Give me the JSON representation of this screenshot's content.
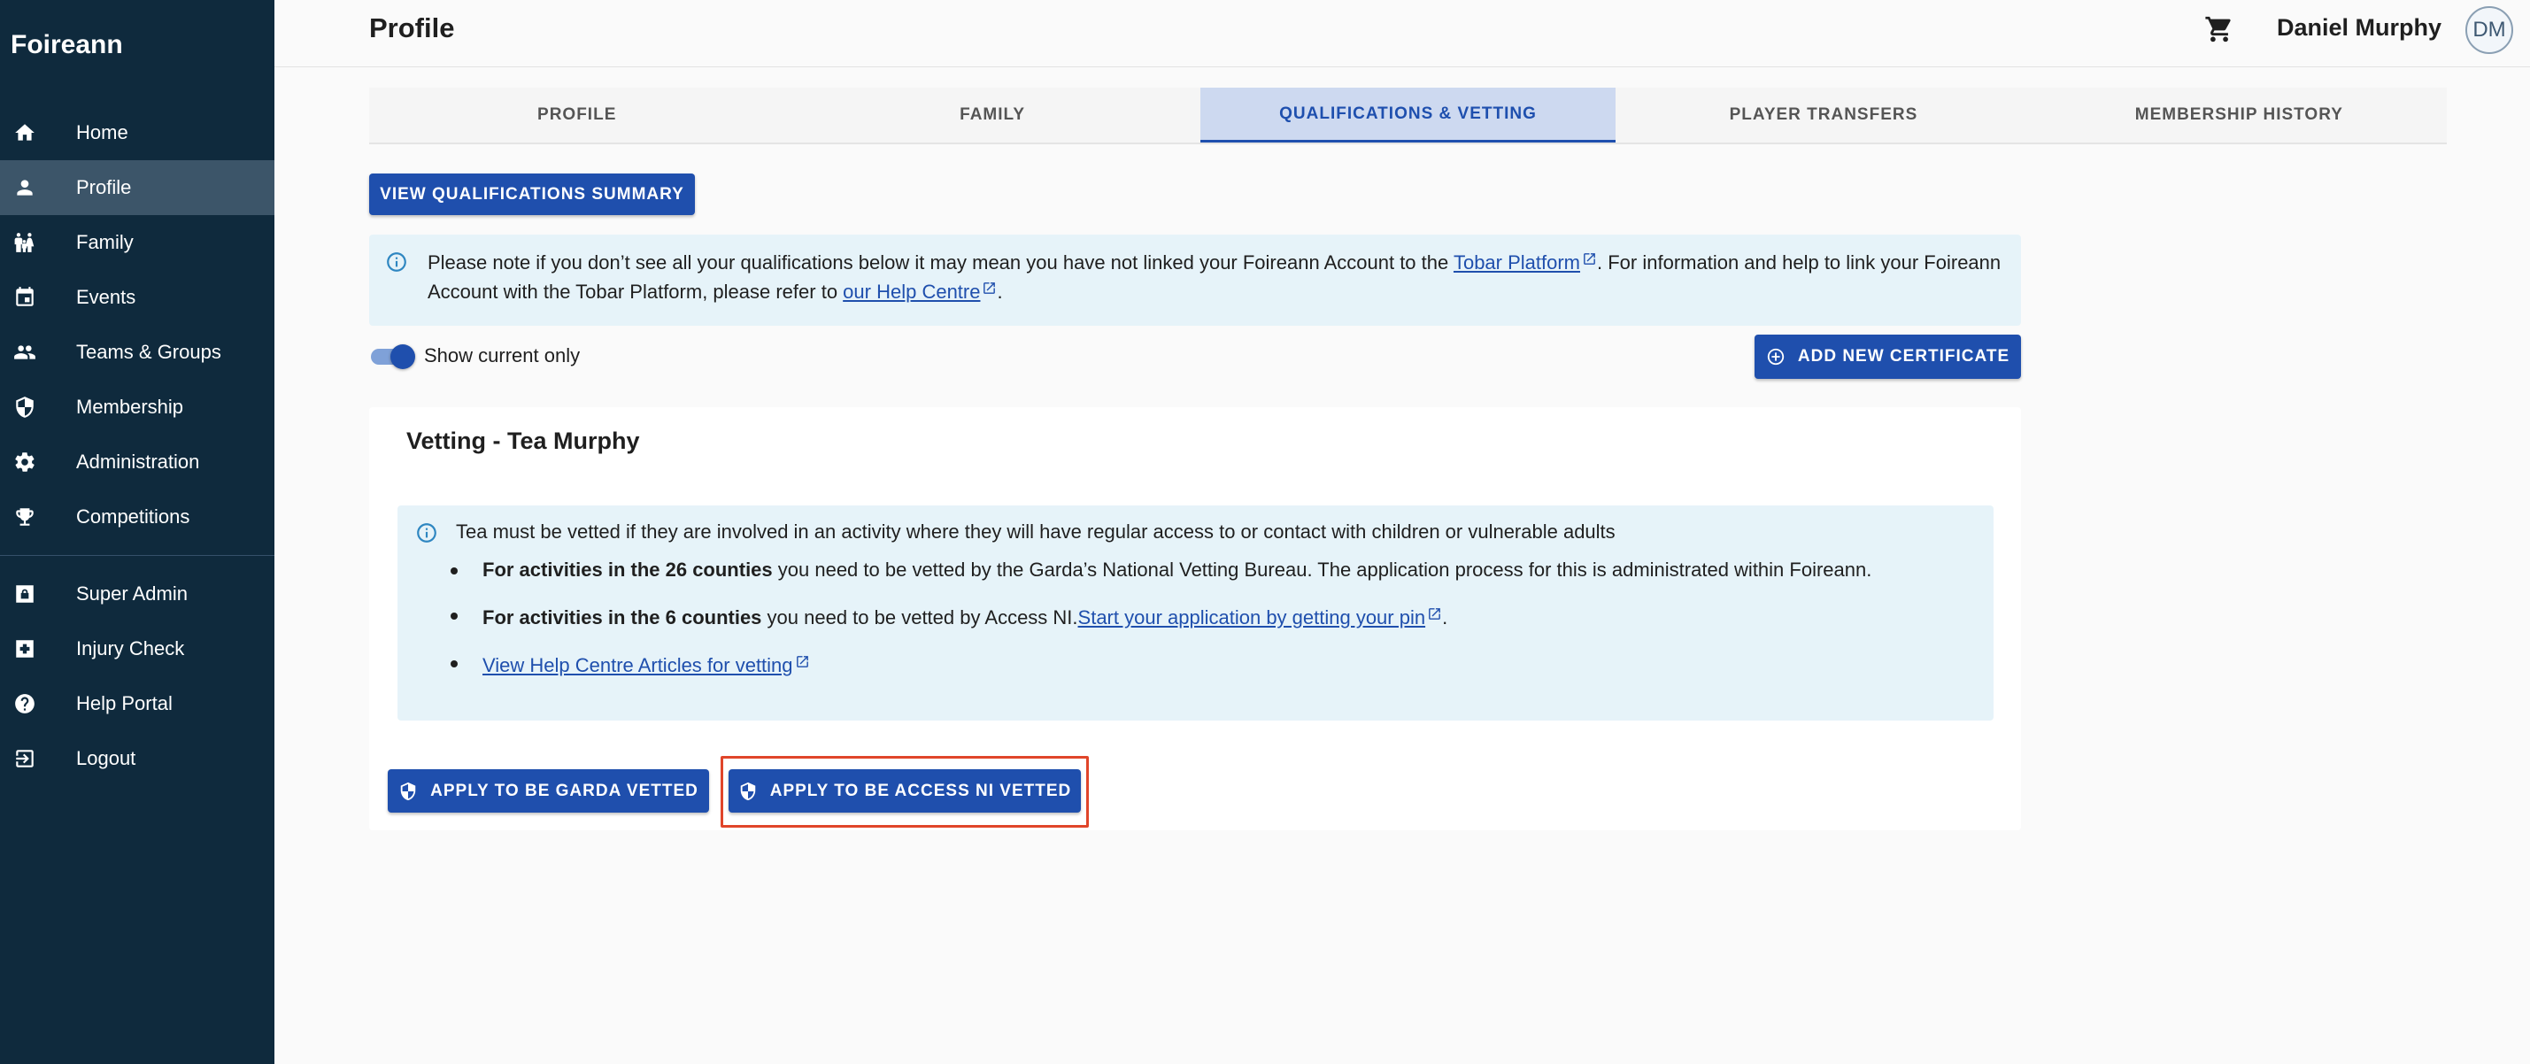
{
  "app": {
    "brand": "Foireann"
  },
  "sidebar": {
    "items": [
      {
        "label": "Home",
        "icon": "home-icon"
      },
      {
        "label": "Profile",
        "icon": "person-icon",
        "active": true
      },
      {
        "label": "Family",
        "icon": "family-icon"
      },
      {
        "label": "Events",
        "icon": "calendar-icon"
      },
      {
        "label": "Teams & Groups",
        "icon": "group-icon"
      },
      {
        "label": "Membership",
        "icon": "shield-icon"
      },
      {
        "label": "Administration",
        "icon": "gear-icon"
      },
      {
        "label": "Competitions",
        "icon": "trophy-icon"
      }
    ],
    "secondary": [
      {
        "label": "Super Admin",
        "icon": "admin-icon"
      },
      {
        "label": "Injury Check",
        "icon": "medical-icon"
      },
      {
        "label": "Help Portal",
        "icon": "help-icon"
      },
      {
        "label": "Logout",
        "icon": "logout-icon"
      }
    ]
  },
  "header": {
    "title": "Profile",
    "username": "Daniel Murphy",
    "avatar_initials": "DM"
  },
  "tabs": [
    {
      "label": "PROFILE"
    },
    {
      "label": "FAMILY"
    },
    {
      "label": "QUALIFICATIONS & VETTING",
      "active": true
    },
    {
      "label": "PLAYER TRANSFERS"
    },
    {
      "label": "MEMBERSHIP HISTORY"
    }
  ],
  "qualifications": {
    "view_summary_label": "VIEW QUALIFICATIONS SUMMARY",
    "notice": {
      "part1": "Please note if you don’t see all your qualifications below it may mean you have not linked your Foireann Account to the ",
      "link1": "Tobar Platform",
      "part2": ". For information and help to link your Foireann Account with the Tobar Platform, please refer to ",
      "link2": "our Help Centre",
      "part3": "."
    },
    "toggle_label": "Show current only",
    "toggle_on": true,
    "add_certificate_label": "ADD NEW CERTIFICATE"
  },
  "vetting": {
    "title": "Vetting - Tea Murphy",
    "intro": "Tea must be vetted if they are involved in an activity where they will have regular access to or contact with children or vulnerable adults",
    "item1_bold": "For activities in the 26 counties",
    "item1_text": " you need to be vetted by the Garda’s National Vetting Bureau. The application process for this is administrated within Foireann.",
    "item2_bold": "For activities in the 6 counties",
    "item2_text": " you need to be vetted by Access NI.",
    "item2_link": "Start your application by getting your pin",
    "item2_end": ".",
    "item3_link": "View Help Centre Articles for vetting",
    "garda_button": "APPLY TO BE GARDA VETTED",
    "accessni_button": "APPLY TO BE ACCESS NI VETTED"
  },
  "colors": {
    "sidebar": "#0f2a3d",
    "primary": "#1f4fad",
    "info_bg": "#e6f3f9",
    "highlight": "#e0452a"
  }
}
